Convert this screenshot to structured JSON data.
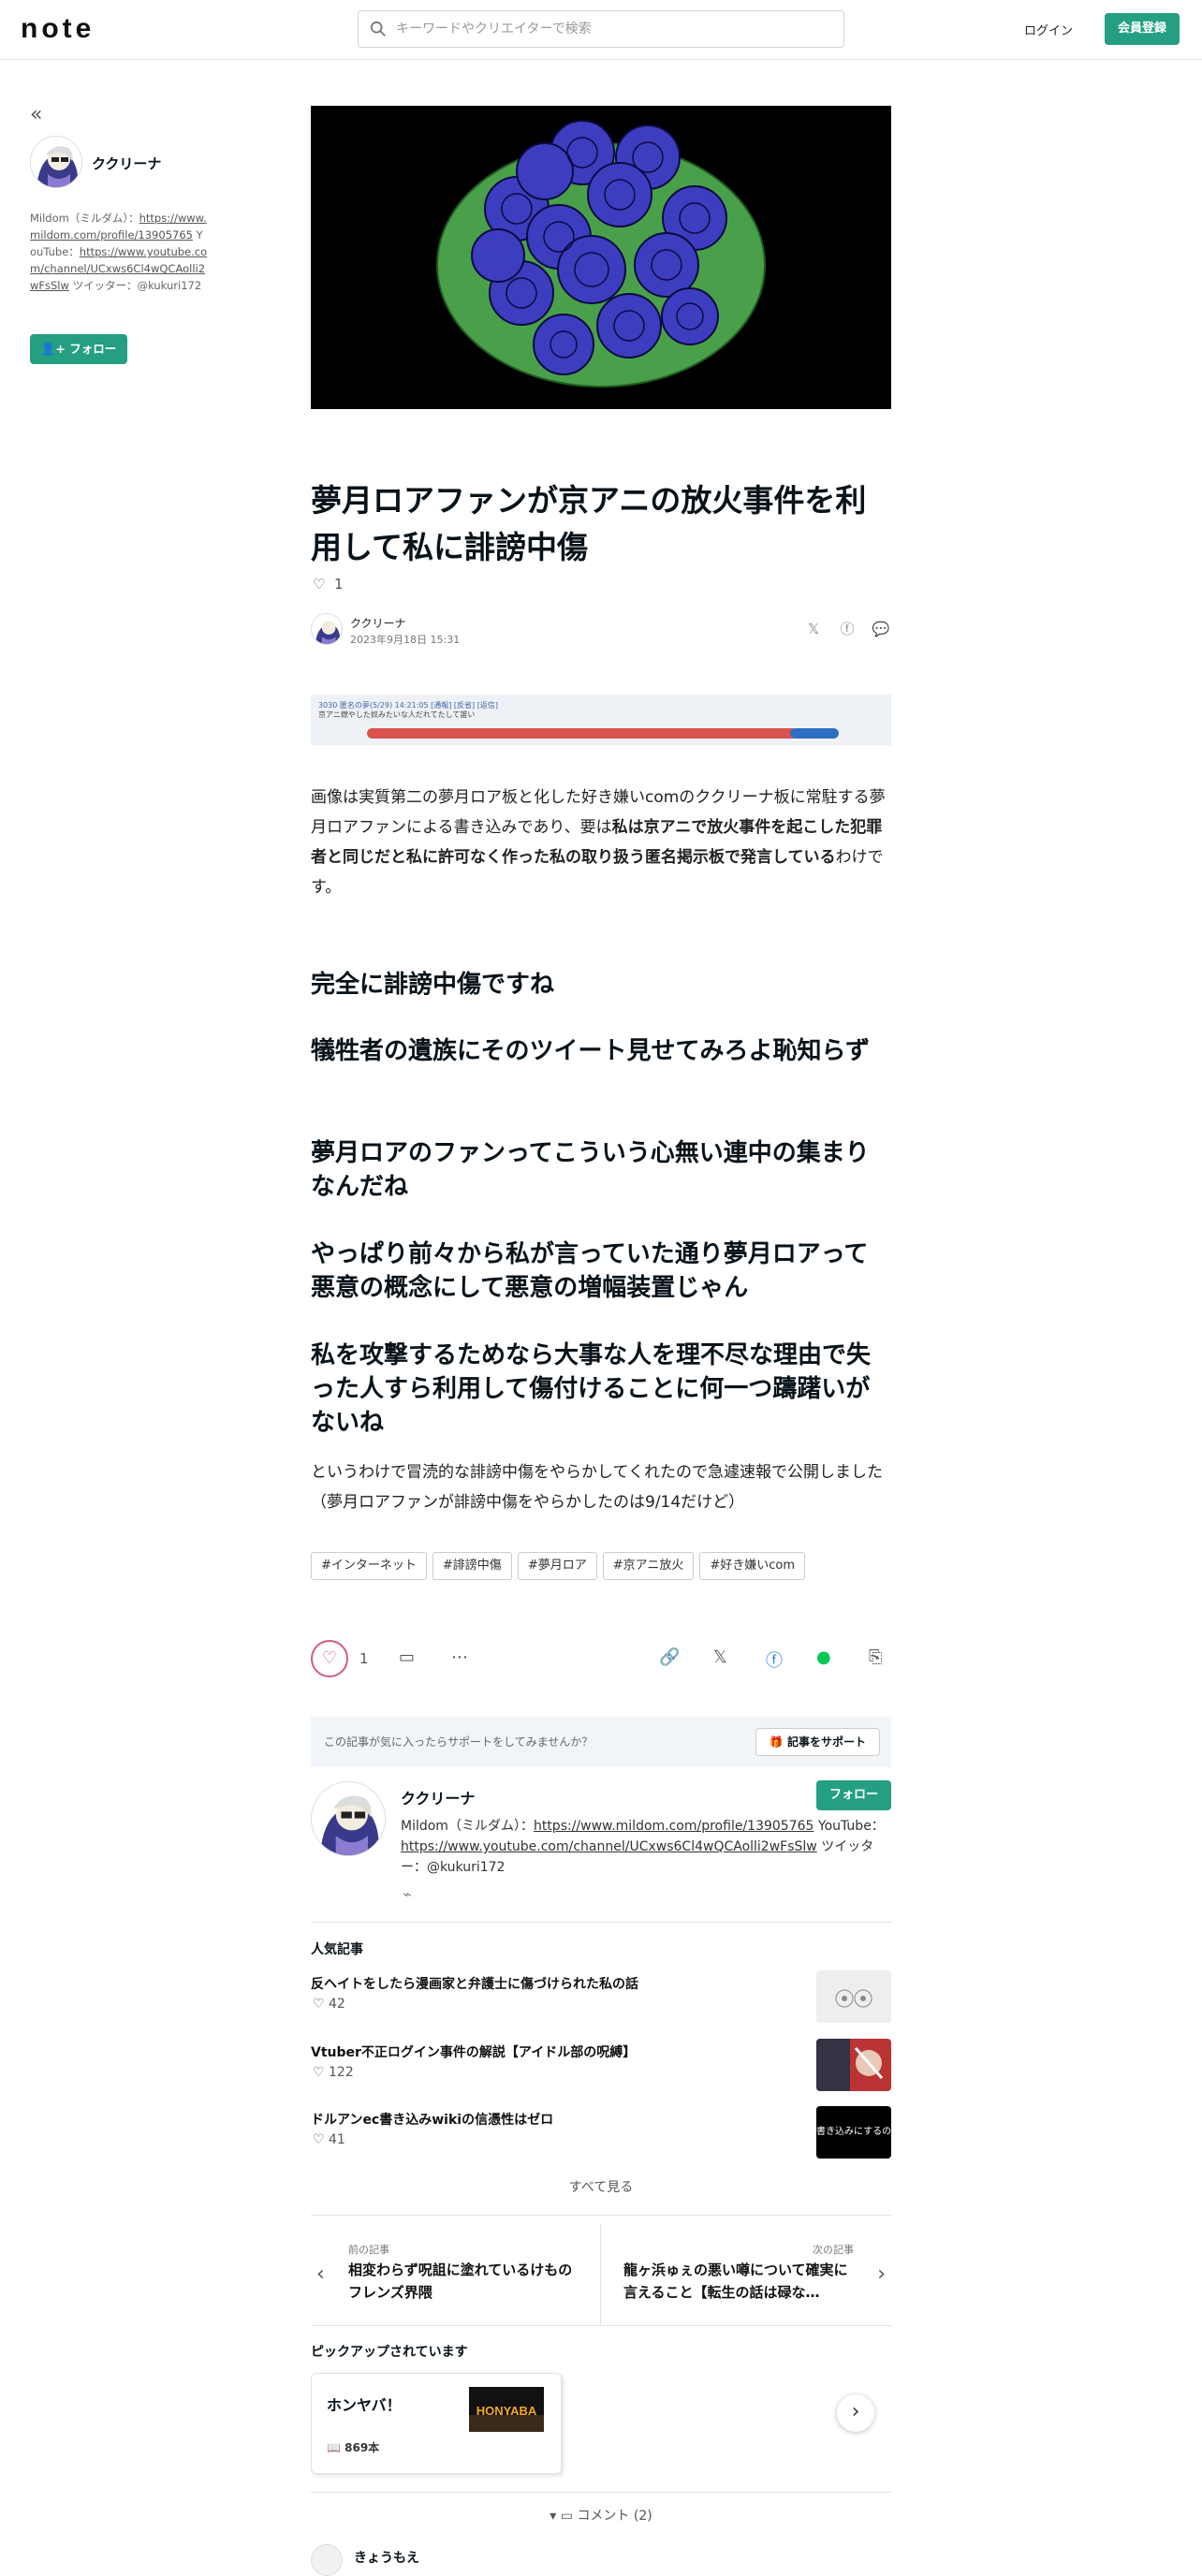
{
  "header": {
    "logo": "note",
    "search_placeholder": "キーワードやクリエイターで検索",
    "login": "ログイン",
    "register": "会員登録"
  },
  "sidebar": {
    "collapse": "«",
    "name": "ククリーナ",
    "bio_prefix": "Mildom（ミルダム）：",
    "bio_link1": "https://www.mildom.com/profile/13905765",
    "bio_mid": " YouTube：",
    "bio_link2": "https://www.youtube.com/channel/UCxws6Cl4wQCAolli2wFsSlw",
    "bio_suffix": " ツイッター：@kukuri172",
    "follow": "フォロー"
  },
  "article": {
    "title": "夢月ロアファンが京アニの放火事件を利用して私に誹謗中傷",
    "like_count": "1",
    "author": "ククリーナ",
    "date": "2023年9月18日 15:31",
    "para1_a": "画像は実質第二の夢月ロア板と化した好き嫌いcomのククリーナ板に常駐する夢月ロアファンによる書き込みであり、要は",
    "para1_b": "私は京アニで放火事件を起こした犯罪者と同じだと私に許可なく作った私の取り扱う匿名掲示板で発言している",
    "para1_c": "わけです。",
    "heading1": "完全に誹謗中傷ですね",
    "heading2": "犠牲者の遺族にそのツイート見せてみろよ恥知らず",
    "heading3": "夢月ロアのファンってこういう心無い連中の集まりなんだね",
    "heading4": "やっぱり前々から私が言っていた通り夢月ロアって悪意の概念にして悪意の増幅装置じゃん",
    "heading5": "私を攻撃するためなら大事な人を理不尽な理由で失った人すら利用して傷付けることに何一つ躊躇いがないね",
    "para2": "というわけで冒涜的な誹謗中傷をやらかしてくれたので急遽速報で公開しました（夢月ロアファンが誹謗中傷をやらかしたのは9/14だけど）",
    "tags": [
      "#インターネット",
      "#誹謗中傷",
      "#夢月ロア",
      "#京アニ放火",
      "#好き嫌いcom"
    ]
  },
  "actions": {
    "like_count": "1"
  },
  "support": {
    "label": "この記事が気に入ったらサポートをしてみませんか？",
    "button": "記事をサポート"
  },
  "profile": {
    "name": "ククリーナ",
    "follow": "フォロー",
    "bio_prefix": "Mildom（ミルダム）：",
    "bio_link1": "https://www.mildom.com/profile/13905765",
    "bio_mid": " YouTube：",
    "bio_link2": "https://www.youtube.com/channel/UCxws6Cl4wQCAolli2wFsSlw",
    "bio_suffix": " ツイッター：@kukuri172"
  },
  "popular": {
    "title": "人気記事",
    "items": [
      {
        "title": "反ヘイトをしたら漫画家と弁護士に傷づけられた私の話",
        "likes": "42"
      },
      {
        "title": "Vtuber不正ログイン事件の解説【アイドル部の呪縛】",
        "likes": "122"
      },
      {
        "title": "ドルアンec書き込みwikiの信憑性はゼロ",
        "likes": "41"
      }
    ],
    "thumb3_text": "書き込みにするのか...",
    "see_all": "すべて見る"
  },
  "nav": {
    "prev_label": "前の記事",
    "prev_title": "相変わらず呪詛に塗れているけものフレンズ界隈",
    "next_label": "次の記事",
    "next_title": "龍ヶ浜ゅぇの悪い噂について確実に言えること【転生の話は碌な…"
  },
  "pickup": {
    "title": "ピックアップされています",
    "card_name": "ホンヤバ！",
    "card_count": "869本",
    "card_img_text": "HONYABA"
  },
  "comments": {
    "label": "コメント (2)",
    "first_commenter": "きょうもえ"
  },
  "thumb_texts": {
    "line1": "3030 匿名の夢(5/29) 14:21:05 [通報] [反省] [返信]",
    "line2": "京アニ燃やした奴みたいな人だれてたして誰い"
  },
  "colors": {
    "accent": "#249f82",
    "heart": "#d65a7b"
  }
}
